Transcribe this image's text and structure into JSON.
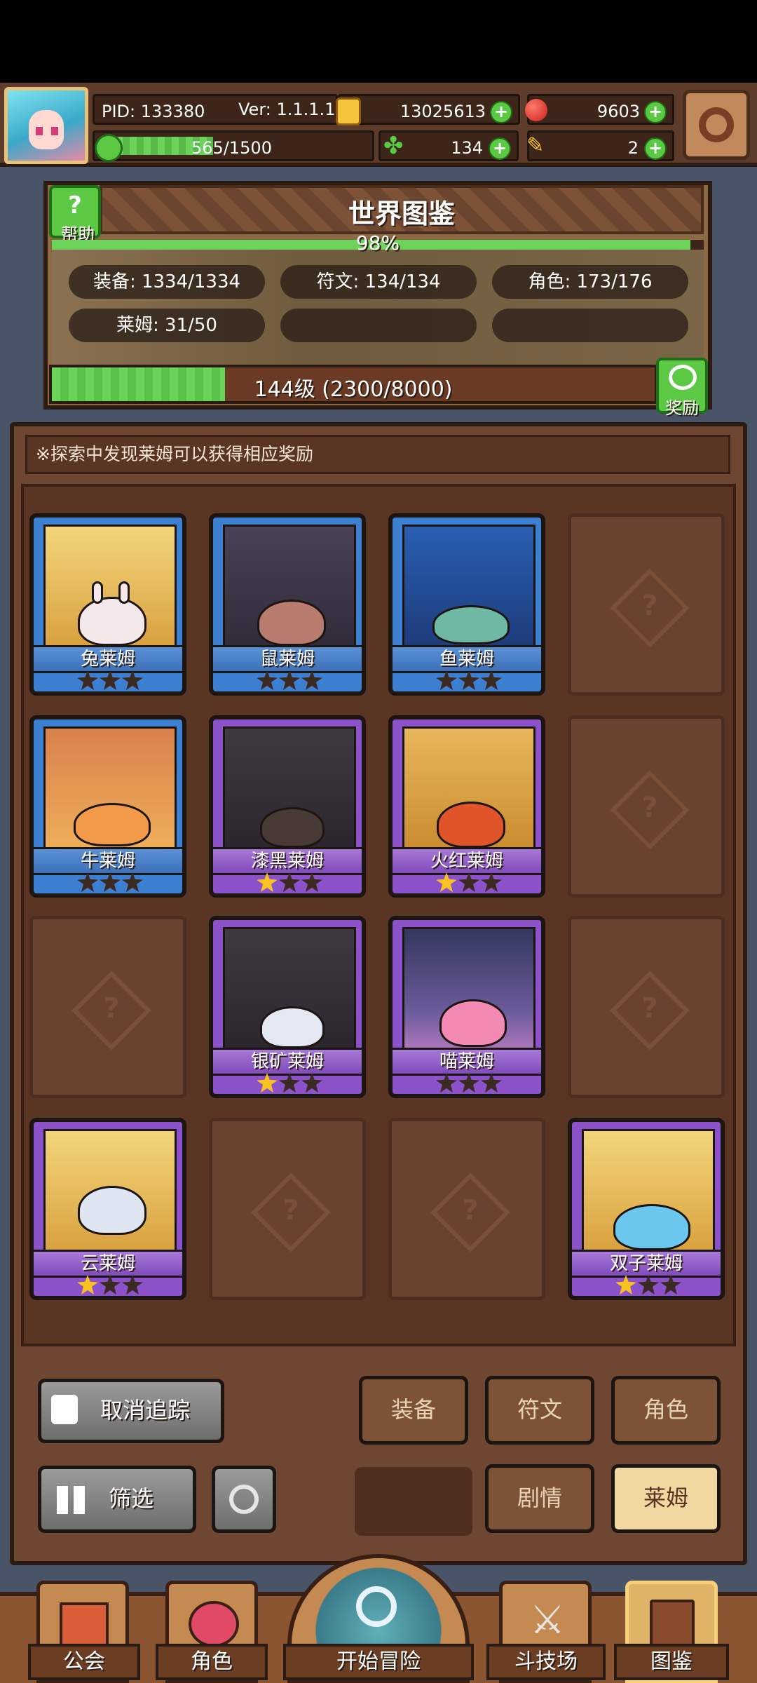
{
  "hud": {
    "pid": "PID: 133380",
    "version": "Ver: 1.1.1.1",
    "gold": "13025613",
    "gems": "9603",
    "xp": "565/1500",
    "xp_progress": 0.377,
    "clover": "134",
    "feather": "2"
  },
  "encyclopedia": {
    "title": "世界图鉴",
    "help": "帮助",
    "percent": "98%",
    "percent_value": 0.98,
    "stats": {
      "equipment": "装备: 1334/1334",
      "rune": "符文: 134/134",
      "character": "角色: 173/176",
      "slime": "莱姆: 31/50"
    },
    "level": "144级 (2300/8000)",
    "level_progress": 0.2875,
    "reward": "奖励"
  },
  "notice": "※探索中发现莱姆可以获得相应奖励",
  "cards": [
    {
      "name": "兔莱姆",
      "frame": "blue",
      "stars": 0
    },
    {
      "name": "鼠莱姆",
      "frame": "blue",
      "stars": 0
    },
    {
      "name": "鱼莱姆",
      "frame": "blue",
      "stars": 0
    },
    {
      "name": "",
      "frame": "locked",
      "stars": 0
    },
    {
      "name": "牛莱姆",
      "frame": "blue",
      "stars": 0
    },
    {
      "name": "漆黑莱姆",
      "frame": "purple",
      "stars": 1
    },
    {
      "name": "火红莱姆",
      "frame": "purple",
      "stars": 1
    },
    {
      "name": "",
      "frame": "locked",
      "stars": 0
    },
    {
      "name": "",
      "frame": "locked",
      "stars": 0
    },
    {
      "name": "银矿莱姆",
      "frame": "purple",
      "stars": 1
    },
    {
      "name": "喵莱姆",
      "frame": "purple",
      "stars": 0
    },
    {
      "name": "",
      "frame": "locked",
      "stars": 0
    },
    {
      "name": "云莱姆",
      "frame": "purple",
      "stars": 1
    },
    {
      "name": "",
      "frame": "locked",
      "stars": 0
    },
    {
      "name": "",
      "frame": "locked",
      "stars": 0
    },
    {
      "name": "双子莱姆",
      "frame": "purple",
      "stars": 1
    }
  ],
  "controls": {
    "untrack": "取消追踪",
    "filter": "筛选",
    "tabs": {
      "equipment": "装备",
      "rune": "符文",
      "character": "角色",
      "story": "剧情",
      "slime": "莱姆"
    }
  },
  "nav": {
    "guild": "公会",
    "character": "角色",
    "adventure": "开始冒险",
    "arena": "斗技场",
    "codex": "图鉴"
  },
  "colors": {
    "accent_green": "#5cc945",
    "blue_frame": "#3d7fd1",
    "purple_frame": "#8b52c9",
    "star_on": "#f8c31f"
  }
}
